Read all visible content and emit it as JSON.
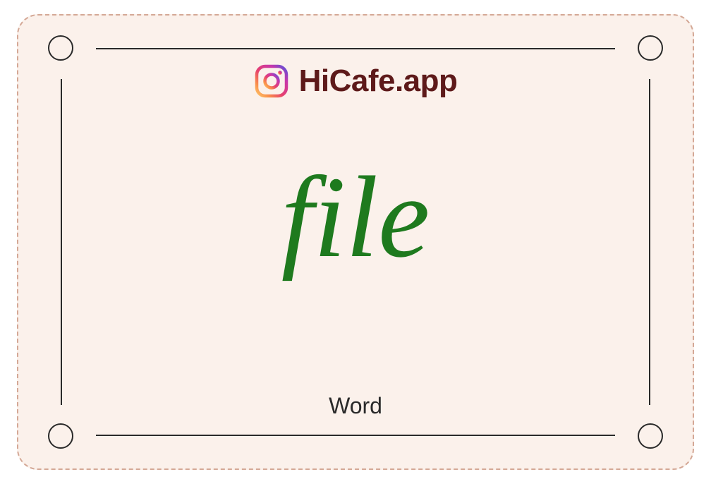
{
  "brand": {
    "name": "HiCafe.app"
  },
  "content": {
    "main_word": "file",
    "caption": "Word"
  },
  "colors": {
    "background": "#fbf1eb",
    "border": "#d4a896",
    "text_dark": "#2a2a2a",
    "brand_text": "#5e1a1a",
    "word_color": "#1e7a1e"
  }
}
